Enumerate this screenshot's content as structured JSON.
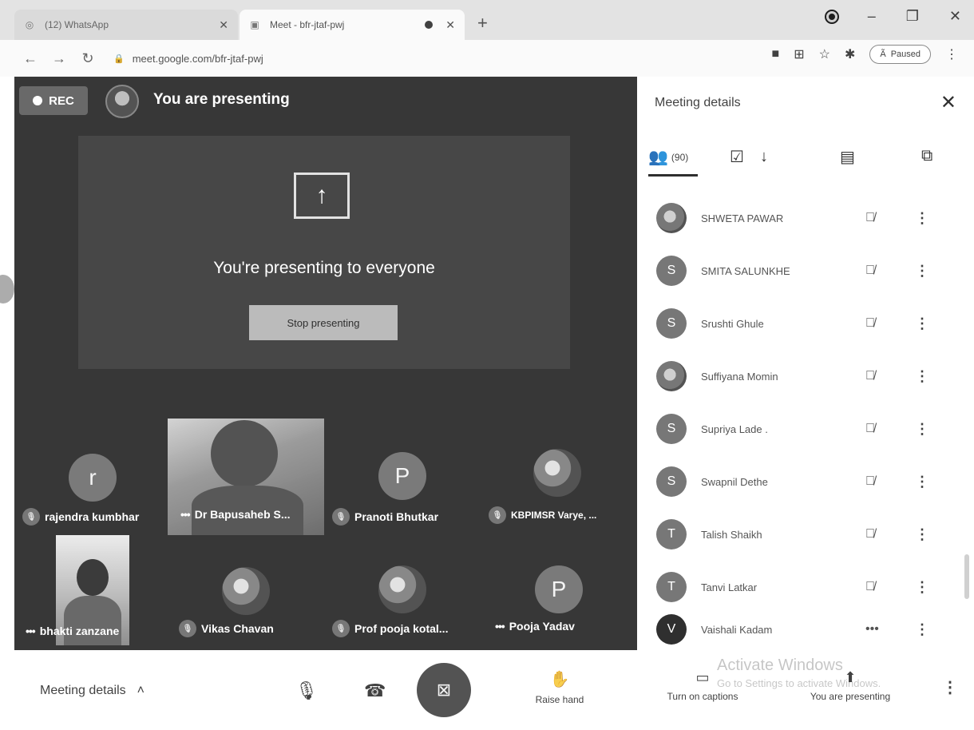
{
  "browser": {
    "tabs": [
      {
        "title": "(12) WhatsApp",
        "active": false
      },
      {
        "title": "Meet - bfr-jtaf-pwj",
        "active": true
      }
    ],
    "url": "meet.google.com/bfr-jtaf-pwj",
    "profile_label": "Paused"
  },
  "stage": {
    "rec_label": "REC",
    "presenter_text": "You are presenting",
    "present_heading": "You're presenting to everyone",
    "stop_button": "Stop presenting",
    "tiles": [
      {
        "name": "rajendra kumbhar",
        "initial": "r",
        "kind": "letter"
      },
      {
        "name": "Dr Bapusaheb S...",
        "initial": "",
        "kind": "video"
      },
      {
        "name": "Pranoti Bhutkar",
        "initial": "P",
        "kind": "letter"
      },
      {
        "name": "KBPIMSR Varye, ...",
        "initial": "",
        "kind": "photo"
      },
      {
        "name": "bhakti zanzane",
        "initial": "",
        "kind": "video"
      },
      {
        "name": "Vikas Chavan",
        "initial": "",
        "kind": "photo"
      },
      {
        "name": "Prof pooja kotal...",
        "initial": "",
        "kind": "photo"
      },
      {
        "name": "Pooja Yadav",
        "initial": "P",
        "kind": "letter"
      }
    ]
  },
  "panel": {
    "title": "Meeting details",
    "people_count": "(90)",
    "participants": [
      {
        "name": "SHWETA PAWAR",
        "initial": "",
        "kind": "photo"
      },
      {
        "name": "SMITA SALUNKHE",
        "initial": "S",
        "kind": "letter"
      },
      {
        "name": "Srushti Ghule",
        "initial": "S",
        "kind": "letter"
      },
      {
        "name": "Suffiyana Momin",
        "initial": "",
        "kind": "photo"
      },
      {
        "name": "Supriya Lade .",
        "initial": "S",
        "kind": "letter"
      },
      {
        "name": "Swapnil Dethe",
        "initial": "S",
        "kind": "letter"
      },
      {
        "name": "Talish Shaikh",
        "initial": "T",
        "kind": "letter"
      },
      {
        "name": "Tanvi Latkar",
        "initial": "T",
        "kind": "letter"
      },
      {
        "name": "Vaishali Kadam",
        "initial": "V",
        "kind": "letter"
      }
    ]
  },
  "bottom": {
    "meeting_details": "Meeting details",
    "raise_hand": "Raise hand",
    "captions": "Turn on captions",
    "presenting": "You are presenting",
    "watermark_title": "Activate Windows",
    "watermark_sub": "Go to Settings to activate Windows."
  }
}
